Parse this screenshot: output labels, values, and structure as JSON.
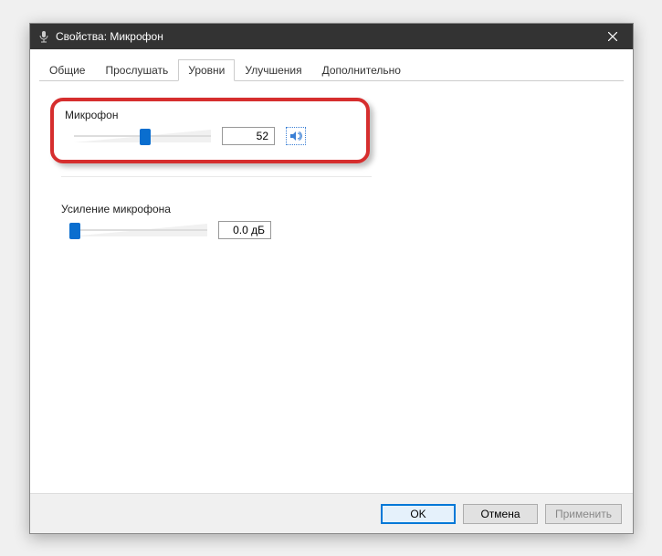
{
  "titlebar": {
    "title": "Свойства: Микрофон"
  },
  "tabs": {
    "t0": "Общие",
    "t1": "Прослушать",
    "t2": "Уровни",
    "t3": "Улучшения",
    "t4": "Дополнительно"
  },
  "mic": {
    "label": "Микрофон",
    "value": "52",
    "percent": 52
  },
  "boost": {
    "label": "Усиление микрофона",
    "value": "0.0 дБ",
    "percent": 3
  },
  "buttons": {
    "ok": "OK",
    "cancel": "Отмена",
    "apply": "Применить"
  }
}
